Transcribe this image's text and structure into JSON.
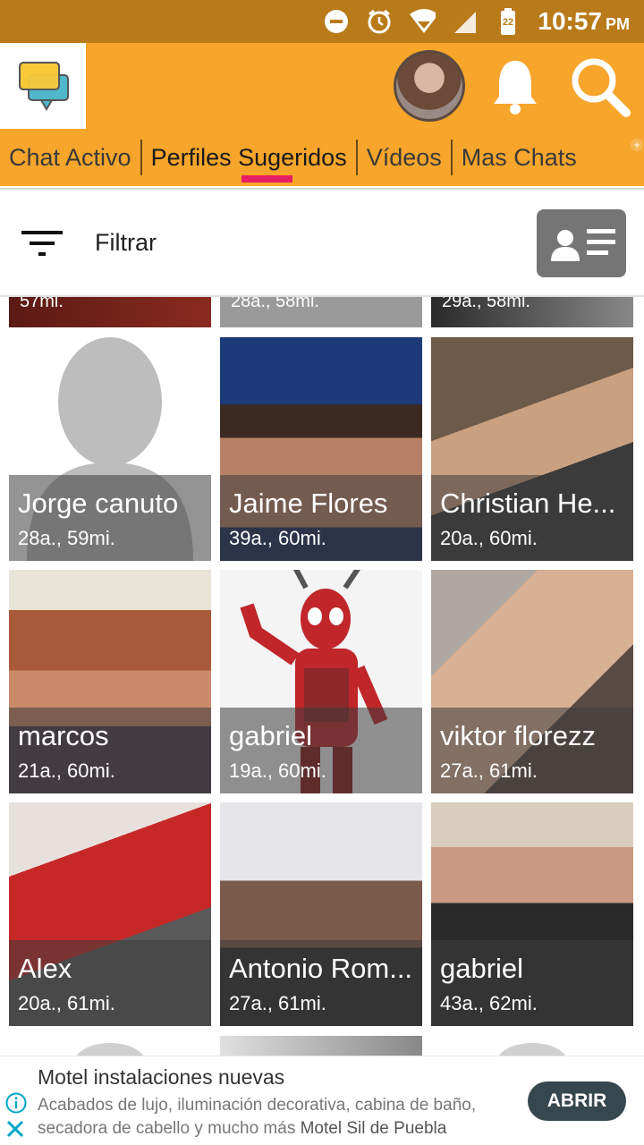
{
  "status_bar": {
    "time": "10:57",
    "ampm": "PM",
    "battery_level": "22"
  },
  "app_bar": {
    "logo": "chat-bubbles-logo",
    "profile_avatar": "user-avatar"
  },
  "tabs": [
    {
      "label": "Chat Activo"
    },
    {
      "label": "Perfiles Sugeridos"
    },
    {
      "label": "Vídeos"
    },
    {
      "label": "Mas Chats"
    }
  ],
  "active_tab": "Perfiles Sugeridos",
  "filter": {
    "label": "Filtrar"
  },
  "partial_row": [
    "57mi.",
    "28a., 58mi.",
    "29a., 58mi."
  ],
  "profiles": [
    {
      "name": "Jorge canuto",
      "meta": "28a., 59mi."
    },
    {
      "name": "Jaime Flores",
      "meta": "39a., 60mi."
    },
    {
      "name": "Christian He...",
      "meta": "20a., 60mi."
    },
    {
      "name": "marcos",
      "meta": "21a., 60mi."
    },
    {
      "name": "gabriel",
      "meta": "19a., 60mi."
    },
    {
      "name": "viktor florezz",
      "meta": "27a., 61mi."
    },
    {
      "name": "Alex",
      "meta": "20a., 61mi."
    },
    {
      "name": "Antonio Rom...",
      "meta": "27a., 61mi."
    },
    {
      "name": "gabriel",
      "meta": "43a., 62mi."
    }
  ],
  "ad": {
    "title": "Motel instalaciones nuevas",
    "body": "Acabados de lujo, iluminación decorativa, cabina de baño, secadora de cabello y mucho más",
    "advertiser": "Motel Sil de Puebla",
    "button": "ABRIR"
  },
  "colors": {
    "accent": "#f7a52b",
    "status_bar": "#b97a1a",
    "tab_indicator": "#e91e63"
  }
}
